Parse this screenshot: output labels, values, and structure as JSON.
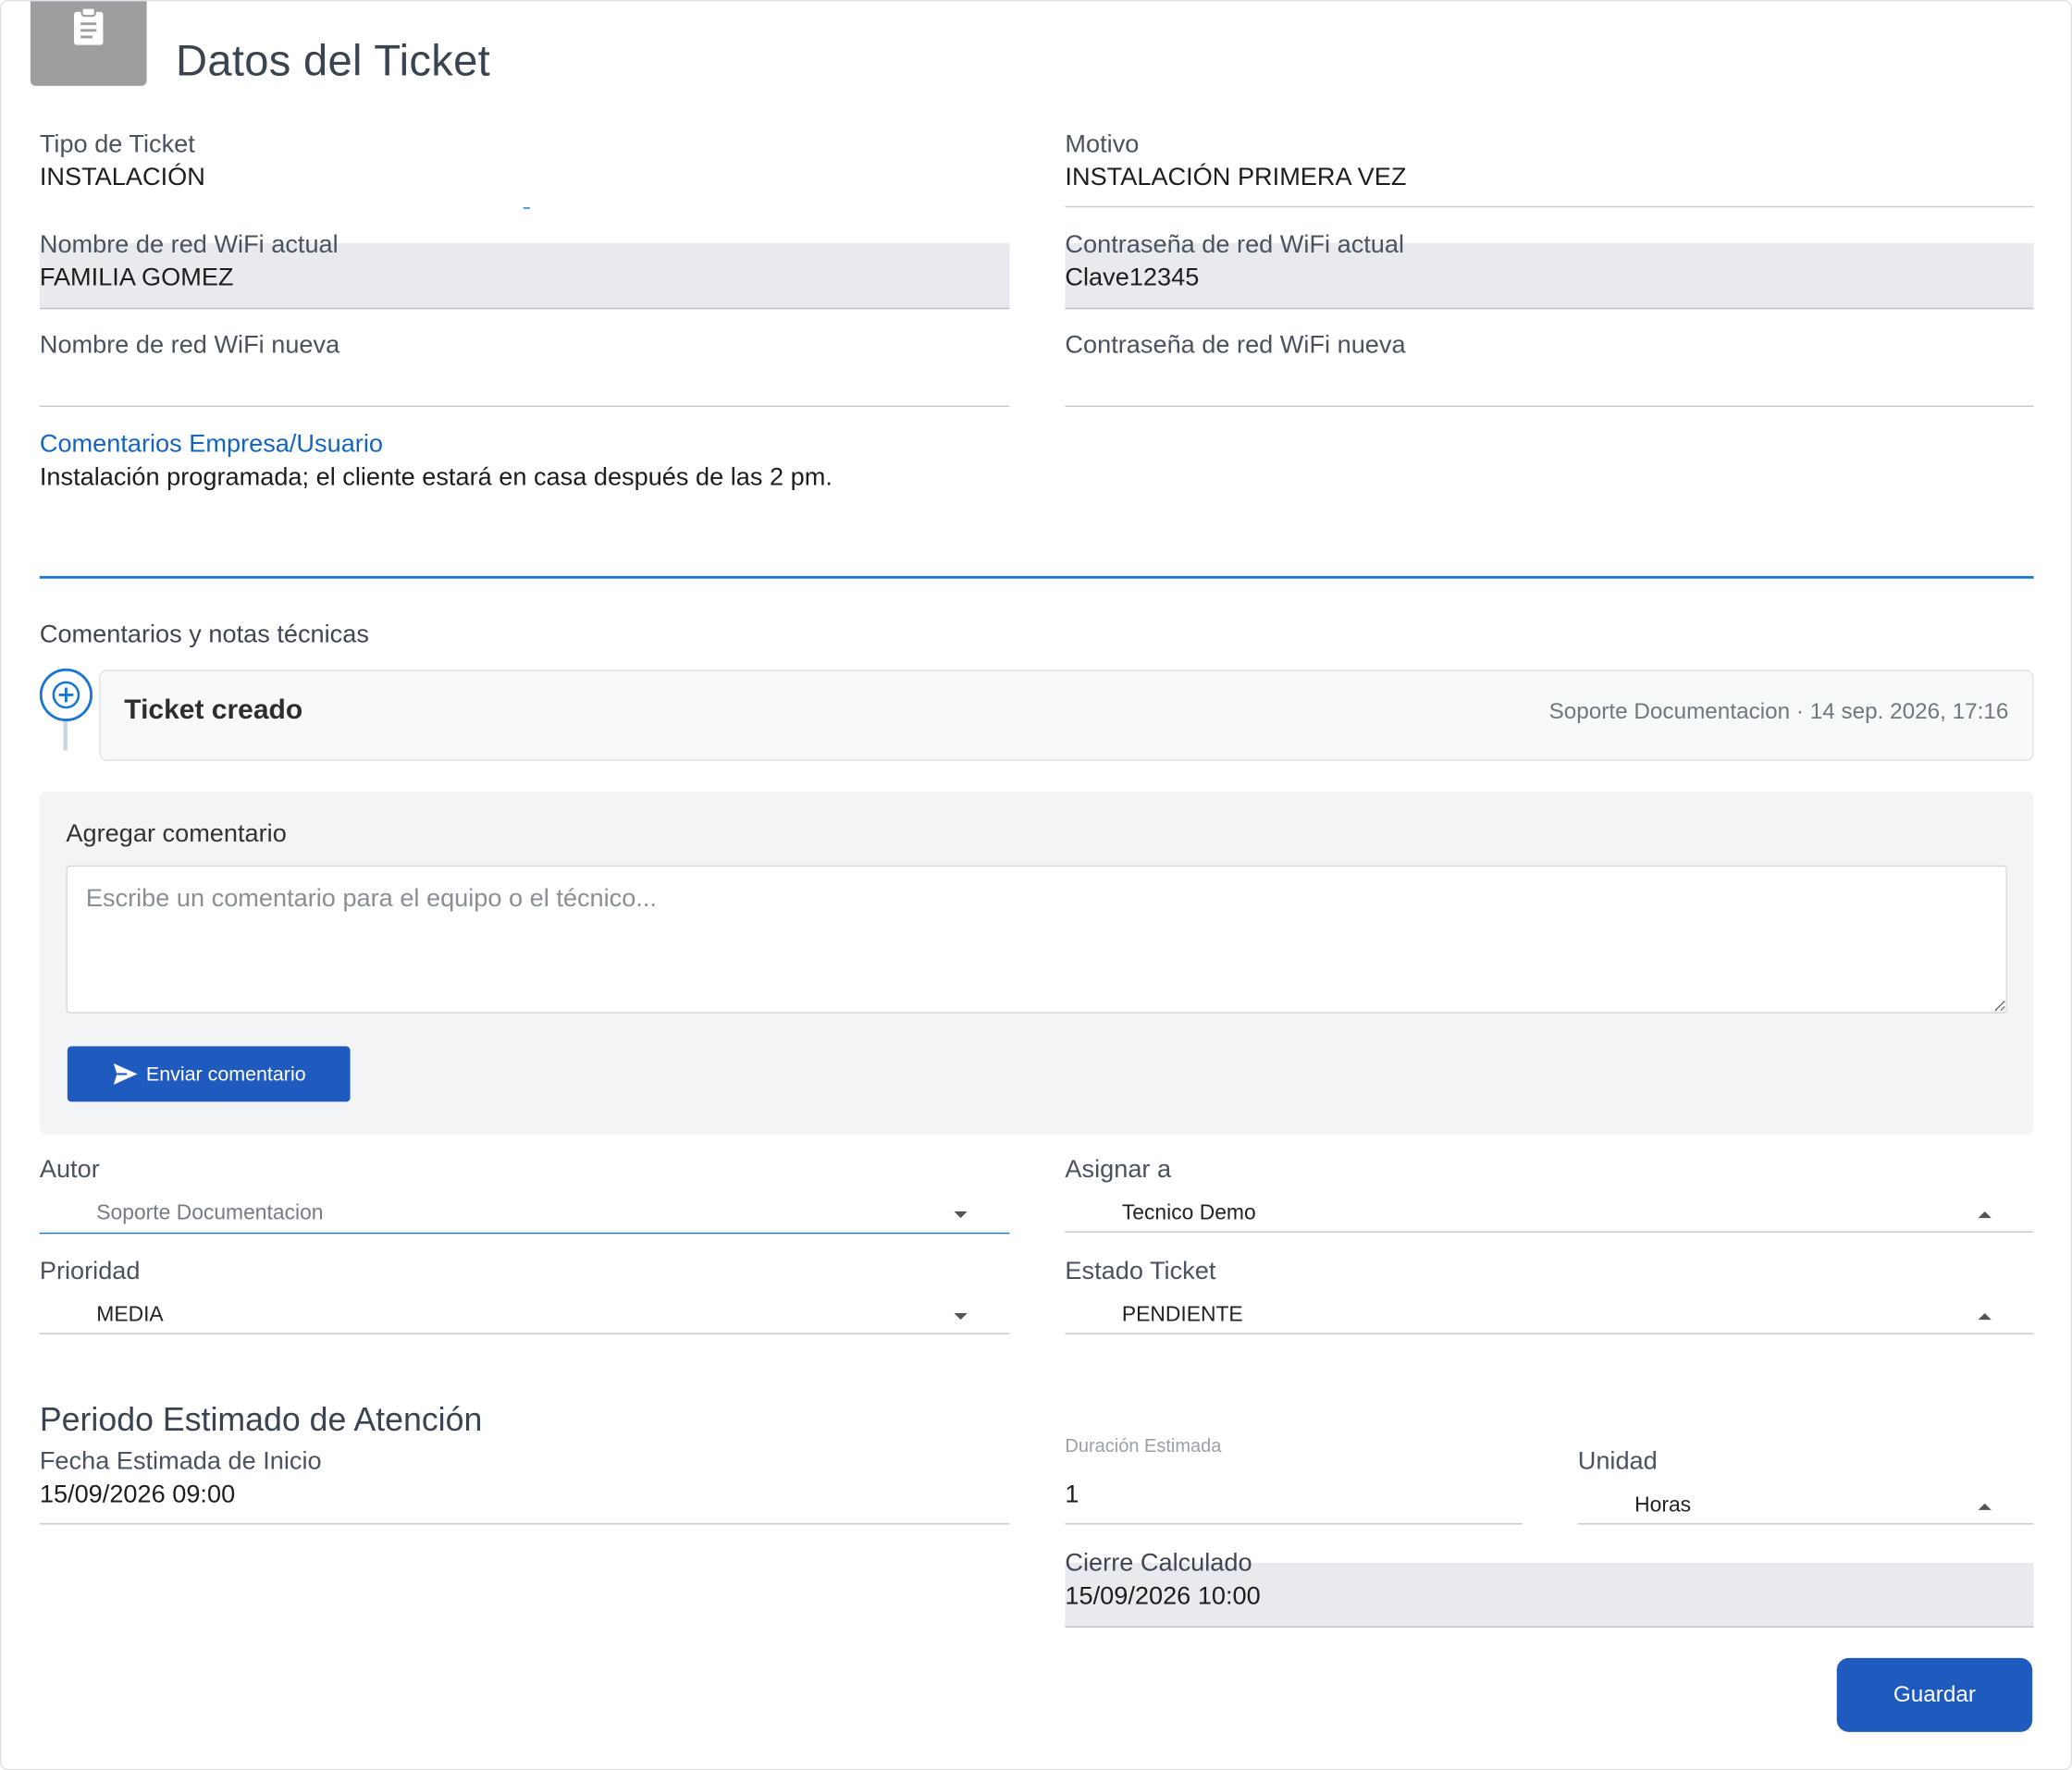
{
  "header": {
    "title": "Datos del Ticket",
    "icon": "clipboard-icon"
  },
  "ticket": {
    "tipo_label": "Tipo de Ticket",
    "tipo_value": "INSTALACIÓN",
    "motivo_label": "Motivo",
    "motivo_value": "INSTALACIÓN PRIMERA VEZ",
    "wifi_actual_label": "Nombre de red WiFi actual",
    "wifi_actual_value": "FAMILIA GOMEZ",
    "pass_actual_label": "Contraseña de red WiFi actual",
    "pass_actual_value": "Clave12345",
    "wifi_nueva_label": "Nombre de red WiFi nueva",
    "wifi_nueva_value": "",
    "pass_nueva_label": "Contraseña de red WiFi nueva",
    "pass_nueva_value": "",
    "comentarios_label": "Comentarios Empresa/Usuario",
    "comentarios_value": "Instalación programada; el cliente estará en casa después de las 2 pm."
  },
  "notes": {
    "section_label": "Comentarios y notas técnicas",
    "timeline": [
      {
        "title": "Ticket creado",
        "meta": "Soporte Documentacion · 14 sep. 2026, 17:16"
      }
    ],
    "add_label": "Agregar comentario",
    "placeholder": "Escribe un comentario para el equipo o el técnico...",
    "send_label": "Enviar comentario"
  },
  "assignment": {
    "autor_label": "Autor",
    "autor_value": "Soporte Documentacion",
    "asignar_label": "Asignar a",
    "asignar_value": "Tecnico Demo",
    "prioridad_label": "Prioridad",
    "prioridad_value": "MEDIA",
    "estado_label": "Estado Ticket",
    "estado_value": "PENDIENTE"
  },
  "periodo": {
    "title": "Periodo Estimado de Atención",
    "inicio_label": "Fecha Estimada de Inicio",
    "inicio_value": "15/09/2026 09:00",
    "duracion_label": "Duración Estimada",
    "duracion_value": "1",
    "unidad_label": "Unidad",
    "unidad_value": "Horas",
    "cierre_label": "Cierre Calculado",
    "cierre_value": "15/09/2026 10:00"
  },
  "actions": {
    "save_label": "Guardar"
  },
  "colors": {
    "primary": "#1f5bbf",
    "accent_blue": "#1976d2",
    "header_icon_bg": "#9e9e9e",
    "filled_bg": "#e8eaed"
  }
}
